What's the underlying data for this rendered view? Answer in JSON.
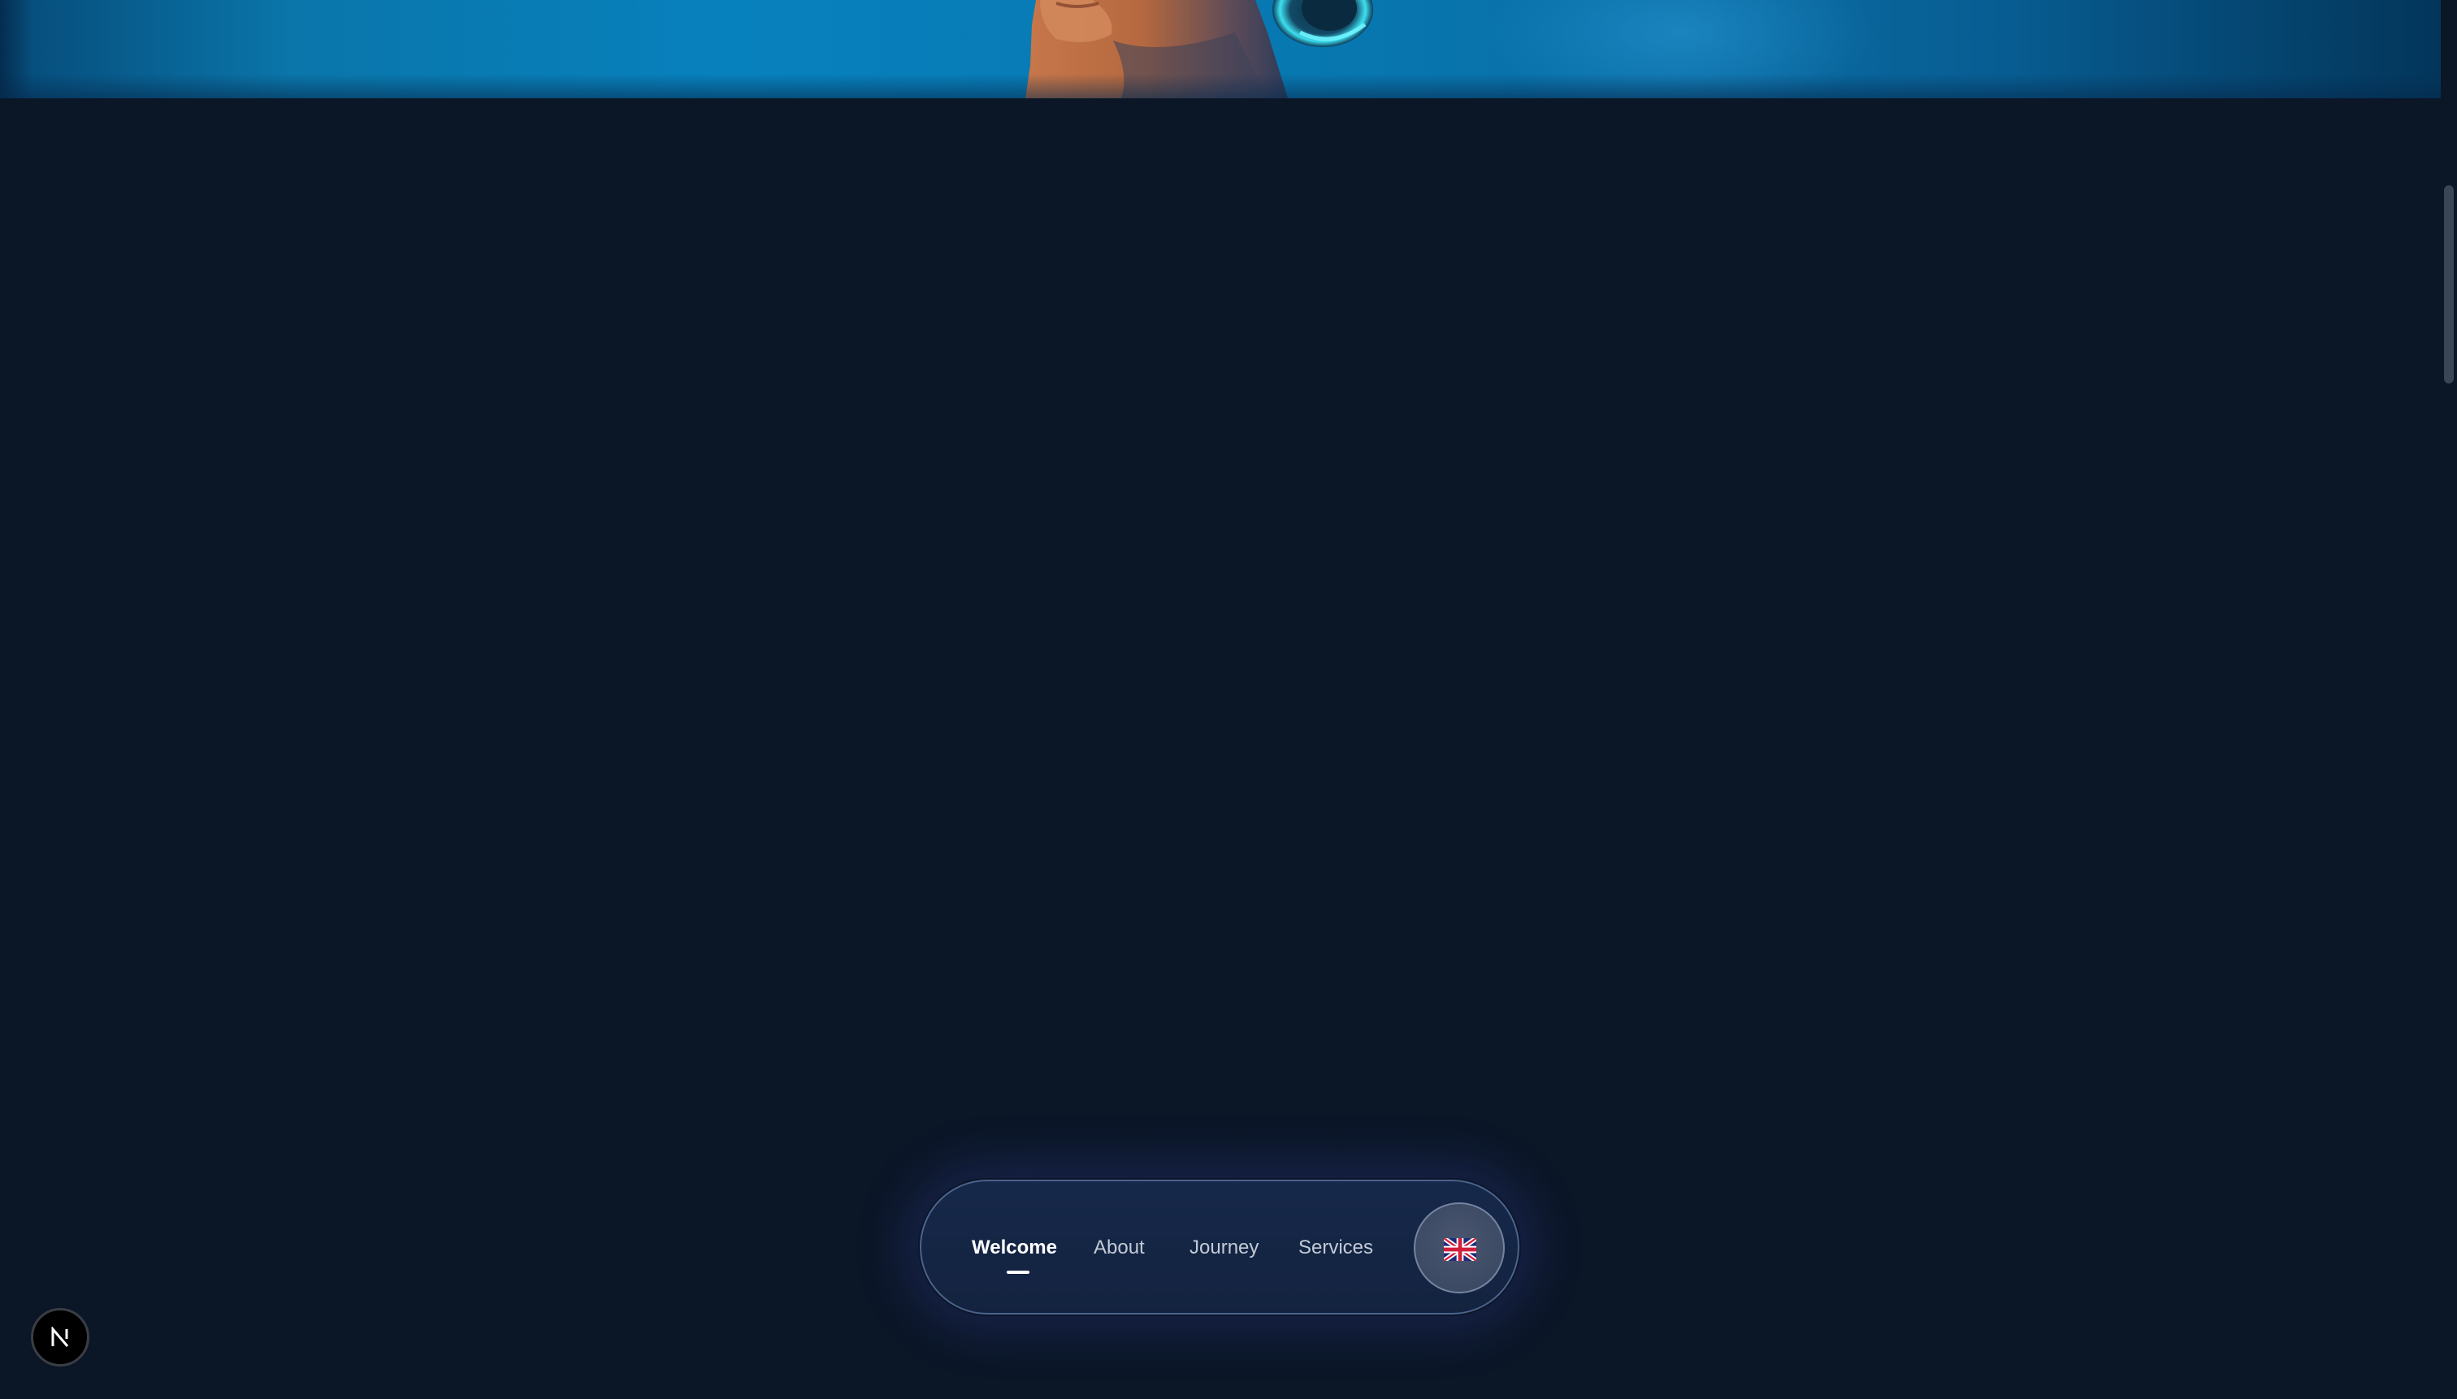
{
  "nav": {
    "items": [
      {
        "label": "Welcome",
        "active": true
      },
      {
        "label": "About",
        "active": false
      },
      {
        "label": "Journey",
        "active": false
      },
      {
        "label": "Services",
        "active": false
      }
    ],
    "language": {
      "icon": "uk-flag-icon"
    }
  },
  "badge": {
    "icon": "nextjs-logo-icon"
  },
  "colors": {
    "background": "#0b1627",
    "nav_background": "#15264a",
    "nav_border": "#7896c8",
    "active_text": "#ffffff",
    "inactive_text": "#c3cad6",
    "hero_blue": "#0781bd"
  }
}
